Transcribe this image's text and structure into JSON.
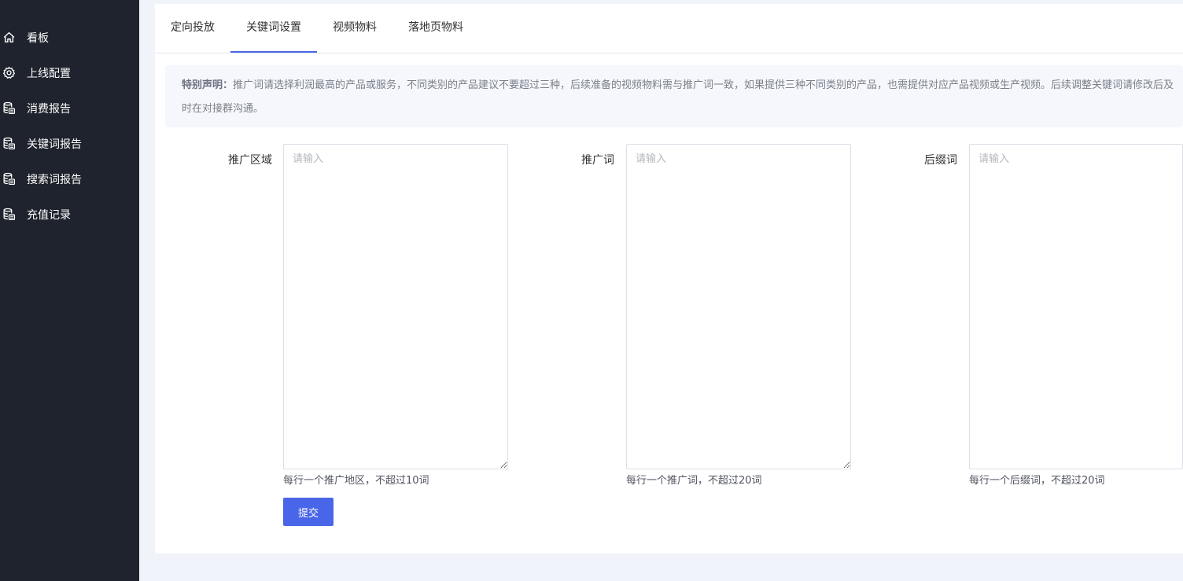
{
  "sidebar": {
    "items": [
      {
        "label": "看板",
        "icon": "home-icon"
      },
      {
        "label": "上线配置",
        "icon": "gear-icon"
      },
      {
        "label": "消费报告",
        "icon": "database-icon"
      },
      {
        "label": "关键词报告",
        "icon": "database-icon"
      },
      {
        "label": "搜索词报告",
        "icon": "database-icon"
      },
      {
        "label": "充值记录",
        "icon": "database-icon"
      }
    ]
  },
  "tabs": [
    {
      "label": "定向投放"
    },
    {
      "label": "关键词设置"
    },
    {
      "label": "视频物料"
    },
    {
      "label": "落地页物料"
    }
  ],
  "notice": {
    "title": "特别声明：",
    "text": "推广词请选择利润最高的产品或服务，不同类别的产品建议不要超过三种，后续准备的视频物料需与推广词一致，如果提供三种不同类别的产品，也需提供对应产品视频或生产视频。后续调整关键词请修改后及时在对接群沟通。"
  },
  "form": {
    "region": {
      "label": "推广区域",
      "placeholder": "请输入",
      "hint": "每行一个推广地区，不超过10词"
    },
    "keyword": {
      "label": "推广词",
      "placeholder": "请输入",
      "hint": "每行一个推广词，不超过20词"
    },
    "suffix": {
      "label": "后缀词",
      "placeholder": "请输入",
      "hint": "每行一个后缀词，不超过20词"
    },
    "submit_label": "提交"
  },
  "colors": {
    "sidebar_bg": "#1f232d",
    "accent": "#4a66e8",
    "page_bg": "#f0f3fa"
  }
}
